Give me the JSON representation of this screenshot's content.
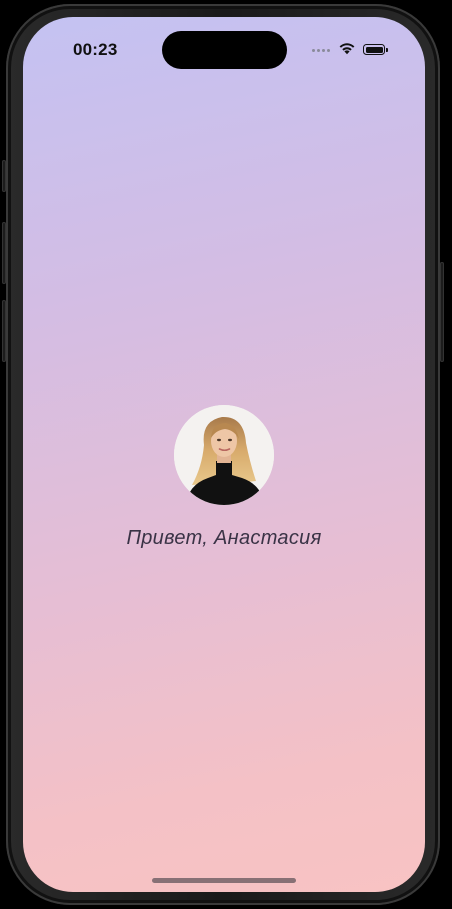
{
  "status_bar": {
    "time": "00:23",
    "signal_icon": "signal-dots-icon",
    "wifi_icon": "wifi-icon",
    "battery_icon": "battery-icon"
  },
  "profile": {
    "avatar_icon": "user-photo-avatar",
    "greeting": "Привет, Анастасия"
  },
  "colors": {
    "gradient_top": "#c4c2f2",
    "gradient_bottom": "#f8c3c3",
    "text": "#3a3346"
  }
}
